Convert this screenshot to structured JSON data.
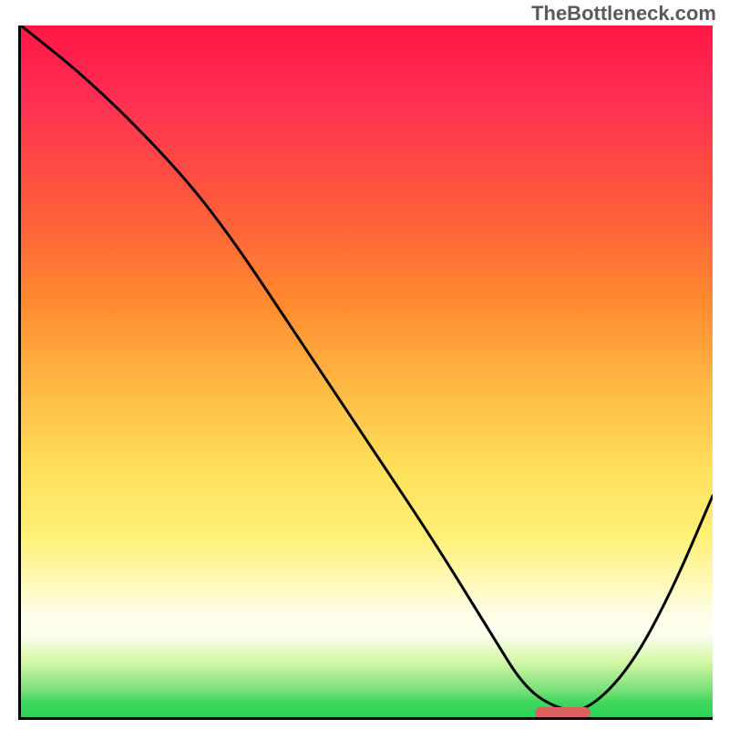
{
  "watermark": "TheBottleneck.com",
  "chart_data": {
    "type": "line",
    "title": "",
    "xlabel": "",
    "ylabel": "",
    "xlim": [
      0,
      100
    ],
    "ylim": [
      0,
      100
    ],
    "grid": false,
    "series": [
      {
        "name": "curve",
        "x": [
          0,
          10,
          22,
          30,
          40,
          50,
          60,
          68,
          73,
          78,
          82,
          88,
          94,
          100
        ],
        "values": [
          100,
          92,
          80,
          70,
          55,
          40,
          25,
          12,
          4,
          1,
          1,
          7,
          18,
          32
        ]
      }
    ],
    "marker": {
      "x_center": 78,
      "width": 8,
      "y": 1
    },
    "background_gradient": {
      "stops": [
        {
          "pos": 0,
          "color": "#ff1744"
        },
        {
          "pos": 40,
          "color": "#ff8a2e"
        },
        {
          "pos": 70,
          "color": "#fff176"
        },
        {
          "pos": 90,
          "color": "#fdfff0"
        },
        {
          "pos": 100,
          "color": "#2ed158"
        }
      ]
    }
  }
}
